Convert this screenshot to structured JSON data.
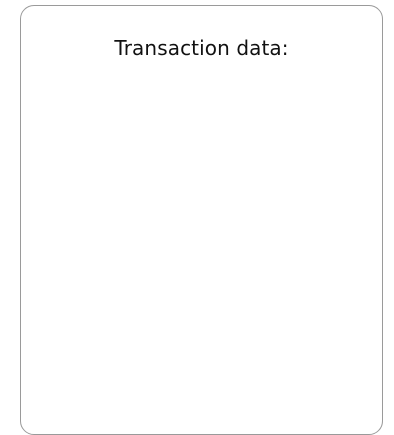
{
  "panel": {
    "title": "Transaction data:"
  }
}
